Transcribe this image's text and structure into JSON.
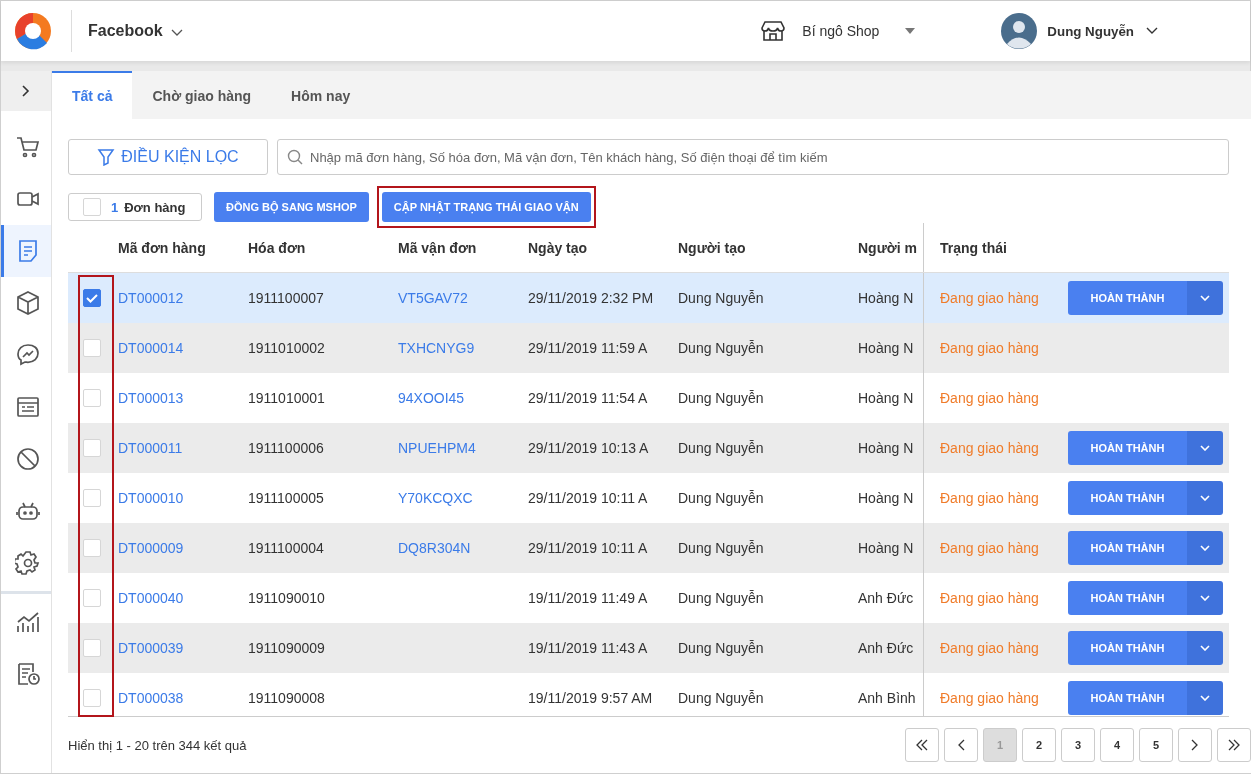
{
  "header": {
    "channel": "Facebook",
    "shop": "Bí ngô Shop",
    "user": "Dung Nguyễn"
  },
  "sidebar": {
    "items": [
      {
        "selected": false
      },
      {
        "selected": false
      },
      {
        "selected": true
      },
      {
        "selected": false
      },
      {
        "selected": false
      },
      {
        "selected": false
      },
      {
        "selected": false
      },
      {
        "selected": false
      },
      {
        "selected": false
      },
      {
        "selected": false
      },
      {
        "selected": false
      }
    ]
  },
  "tabs": [
    {
      "label": "Tất cả",
      "selected": true
    },
    {
      "label": "Chờ giao hàng",
      "selected": false
    },
    {
      "label": "Hôm nay",
      "selected": false
    }
  ],
  "filter_button": "ĐIỀU KIỆN LỌC",
  "search": {
    "placeholder": "Nhập mã đơn hàng, Số hóa đơn, Mã vận đơn, Tên khách hàng, Số điện thoại để tìm kiếm"
  },
  "toolbar": {
    "count": "1",
    "count_label": "Đơn hàng",
    "all_checked": false,
    "buttons": [
      {
        "label": "ĐỒNG BỘ SANG MSHOP",
        "highlighted": false
      },
      {
        "label": "CẬP NHẬT TRẠNG THÁI GIAO VẬN",
        "highlighted": true
      }
    ]
  },
  "table": {
    "checkbox_column_highlighted": true,
    "columns": [
      "Mã đơn hàng",
      "Hóa đơn",
      "Mã vận đơn",
      "Ngày tạo",
      "Người tạo",
      "Người m",
      "Trạng thái"
    ],
    "rows": [
      {
        "order": "DT000012",
        "invoice": "1911100007",
        "waybill": "VT5GAV72",
        "date": "29/11/2019 2:32 PM",
        "creator": "Dung Nguyễn",
        "buyer": "Hoàng N",
        "status": "Đang giao hàng",
        "action": "HOÀN THÀNH",
        "checked": true,
        "selected": true
      },
      {
        "order": "DT000014",
        "invoice": "1911010002",
        "waybill": "TXHCNYG9",
        "date": "29/11/2019 11:59 A",
        "creator": "Dung Nguyễn",
        "buyer": "Hoàng N",
        "status": "Đang giao hàng",
        "checked": false,
        "selected": false
      },
      {
        "order": "DT000013",
        "invoice": "1911010001",
        "waybill": "94XOOI45",
        "date": "29/11/2019 11:54 A",
        "creator": "Dung Nguyễn",
        "buyer": "Hoàng N",
        "status": "Đang giao hàng",
        "checked": false,
        "selected": false
      },
      {
        "order": "DT000011",
        "invoice": "1911100006",
        "waybill": "NPUEHPM4",
        "date": "29/11/2019 10:13 A",
        "creator": "Dung Nguyễn",
        "buyer": "Hoàng N",
        "status": "Đang giao hàng",
        "action": "HOÀN THÀNH",
        "checked": false,
        "selected": false
      },
      {
        "order": "DT000010",
        "invoice": "1911100005",
        "waybill": "Y70KCQXC",
        "date": "29/11/2019 10:11 A",
        "creator": "Dung Nguyễn",
        "buyer": "Hoàng N",
        "status": "Đang giao hàng",
        "action": "HOÀN THÀNH",
        "checked": false,
        "selected": false
      },
      {
        "order": "DT000009",
        "invoice": "1911100004",
        "waybill": "DQ8R304N",
        "date": "29/11/2019 10:11 A",
        "creator": "Dung Nguyễn",
        "buyer": "Hoàng N",
        "status": "Đang giao hàng",
        "action": "HOÀN THÀNH",
        "checked": false,
        "selected": false
      },
      {
        "order": "DT000040",
        "invoice": "1911090010",
        "date": "19/11/2019 11:49 A",
        "creator": "Dung Nguyễn",
        "buyer": "Anh Đức",
        "status": "Đang giao hàng",
        "action": "HOÀN THÀNH",
        "checked": false,
        "selected": false
      },
      {
        "order": "DT000039",
        "invoice": "1911090009",
        "date": "19/11/2019 11:43 A",
        "creator": "Dung Nguyễn",
        "buyer": "Anh Đức",
        "status": "Đang giao hàng",
        "action": "HOÀN THÀNH",
        "checked": false,
        "selected": false
      },
      {
        "order": "DT000038",
        "invoice": "1911090008",
        "date": "19/11/2019 9:57 AM",
        "creator": "Dung Nguyễn",
        "buyer": "Anh Bình",
        "status": "Đang giao hàng",
        "action": "HOÀN THÀNH",
        "checked": false,
        "selected": false
      }
    ]
  },
  "footer": {
    "summary": "Hiển thị 1 - 20 trên 344 kết quả",
    "pages": [
      {
        "label": "1",
        "selected": true
      },
      {
        "label": "2",
        "selected": false
      },
      {
        "label": "3",
        "selected": false
      },
      {
        "label": "4",
        "selected": false
      },
      {
        "label": "5",
        "selected": false
      }
    ]
  }
}
